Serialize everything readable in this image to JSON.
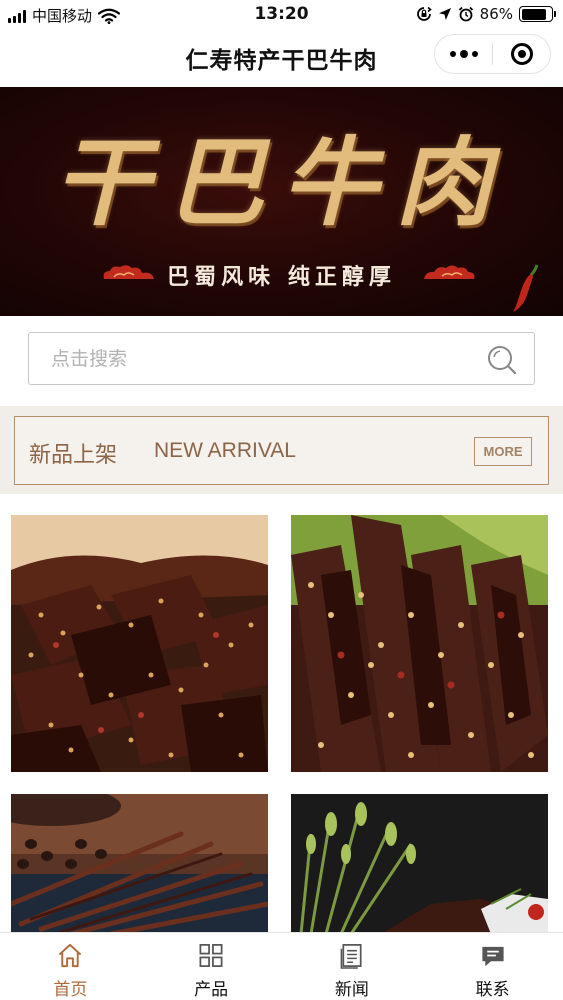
{
  "status_bar": {
    "carrier": "中国移动",
    "time": "13:20",
    "battery": "86%",
    "battery_level": 0.86
  },
  "nav": {
    "title": "仁寿特产干巴牛肉"
  },
  "banner": {
    "title": "干巴牛肉",
    "subtitle": "巴蜀风味 纯正醇厚"
  },
  "search": {
    "placeholder": "点击搜索",
    "icon": "search-icon"
  },
  "section": {
    "title_cn": "新品上架",
    "title_en": "NEW ARRIVAL",
    "more_label": "MORE"
  },
  "products": [
    {
      "image": "spicy-beef-jerky-sesame"
    },
    {
      "image": "beef-jerky-sesame-greens"
    },
    {
      "image": "shredded-beef-coffee-beans"
    },
    {
      "image": "beef-jerky-herbs-dark"
    }
  ],
  "tab_bar": {
    "items": [
      {
        "label": "首页",
        "icon": "home-icon",
        "active": true
      },
      {
        "label": "产品",
        "icon": "grid-icon",
        "active": false
      },
      {
        "label": "新闻",
        "icon": "news-icon",
        "active": false
      },
      {
        "label": "联系",
        "icon": "message-icon",
        "active": false
      }
    ],
    "active_color": "#b06a3c",
    "inactive_color": "#555555"
  },
  "colors": {
    "accent_brown": "#8c6447",
    "banner_gold": "#e2bc7c",
    "banner_bg": "#200605"
  }
}
